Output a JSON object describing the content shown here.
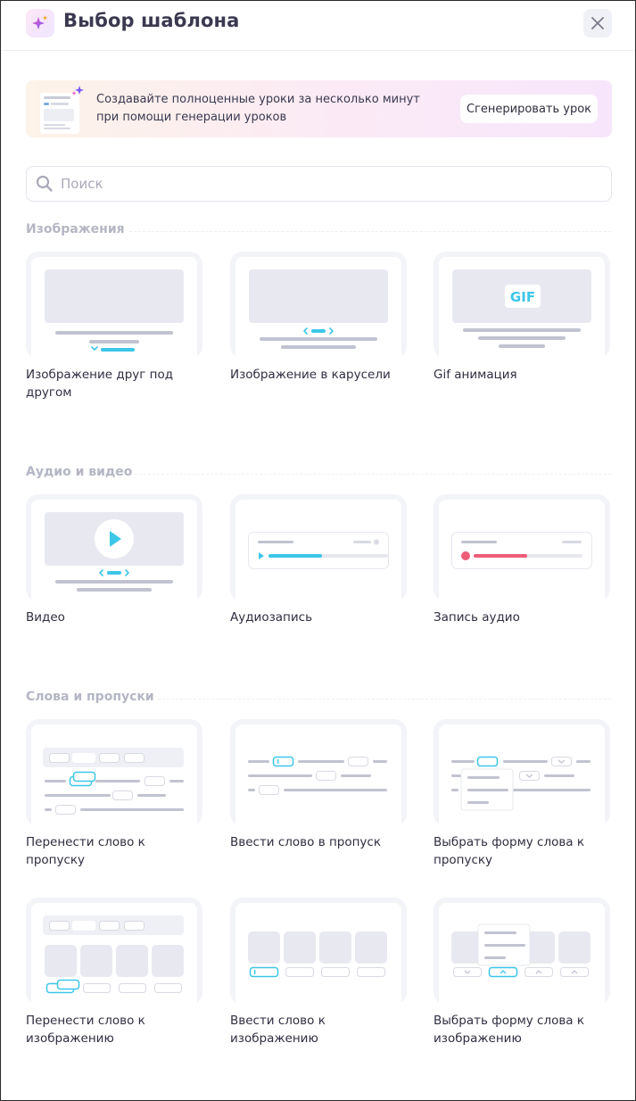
{
  "header": {
    "title": "Выбор шаблона",
    "logo_icon": "sparkles-icon",
    "close_icon": "close-icon"
  },
  "promo": {
    "text_line1": "Создавайте полноценные уроки за несколько минут",
    "text_line2": "при помощи генерации уроков",
    "button_label": "Сгенерировать урок"
  },
  "search": {
    "placeholder": "Поиск",
    "value": "",
    "icon": "search-icon"
  },
  "colors": {
    "accent": "#3cc6e8",
    "record": "#ef5d78",
    "muted": "#b4b6c4",
    "block": "#e8e9f0"
  },
  "sections": [
    {
      "title": "Изображения",
      "cards": [
        {
          "label": "Изображение друг под другом",
          "thumb": "image-stack"
        },
        {
          "label": "Изображение в карусели",
          "thumb": "image-carousel"
        },
        {
          "label": "Gif анимация",
          "thumb": "gif",
          "badge": "GIF"
        }
      ]
    },
    {
      "title": "Аудио и видео",
      "cards": [
        {
          "label": "Видео",
          "thumb": "video"
        },
        {
          "label": "Аудиозапись",
          "thumb": "audio"
        },
        {
          "label": "Запись аудио",
          "thumb": "audio-record"
        }
      ]
    },
    {
      "title": "Слова и пропуски",
      "cards": [
        {
          "label": "Перенести слово к пропуску",
          "thumb": "drag-word-gap"
        },
        {
          "label": "Ввести слово в пропуск",
          "thumb": "type-word-gap"
        },
        {
          "label": "Выбрать форму слова к пропуску",
          "thumb": "select-form-gap"
        },
        {
          "label": "Перенести слово к изображению",
          "thumb": "drag-word-image"
        },
        {
          "label": "Ввести слово к изображению",
          "thumb": "type-word-image"
        },
        {
          "label": "Выбрать форму слова к изображению",
          "thumb": "select-form-image"
        }
      ]
    }
  ]
}
